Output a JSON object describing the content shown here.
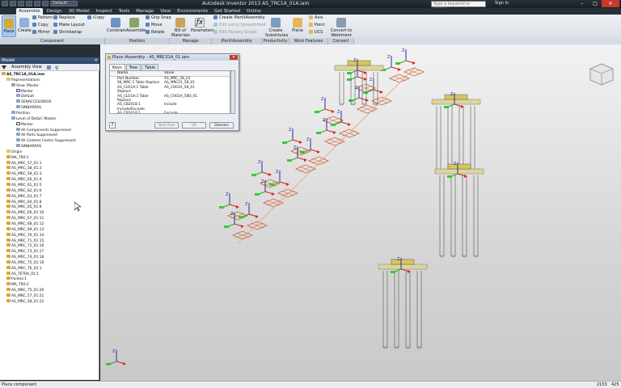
{
  "window": {
    "title": "Autodesk Inventor 2013   AS_TRC1A_01A.iam",
    "project_selector": "Default",
    "search_placeholder": "Type a keyword or phrase",
    "signin": "Sign In",
    "minimize": "–",
    "maximize": "□",
    "close": "✕"
  },
  "ribbon_tabs": [
    "Assemble",
    "Design",
    "3D Model",
    "Inspect",
    "Tools",
    "Manage",
    "View",
    "Environments",
    "Get Started",
    "Online"
  ],
  "ribbon": {
    "place": "Place",
    "create": "Create",
    "pattern": "Pattern",
    "copy": "Copy",
    "mirror": "Mirror",
    "replace": "Replace",
    "make_layout": "Make Layout",
    "shrinkwrap": "Shrinkwrap",
    "icopy": "iCopy",
    "constrain": "Constrain",
    "assemble": "Assemble",
    "grip_snap": "Grip Snap",
    "move": "Move",
    "rotate": "Rotate",
    "bill_of_materials": "Bill of Materials",
    "parameters": "Parameters",
    "create_ipart": "Create iPart/iAssembly",
    "edit_spreadsheet": "Edit using Spreadsheet",
    "edit_factory_scope": "Edit Factory Scope",
    "create_substitutes": "Create Substitutes",
    "plane": "Plane",
    "axis": "Axis",
    "point": "Point",
    "ucs": "UCS",
    "convert_weldment": "Convert to Weldment",
    "panels": {
      "component": "Component",
      "position": "Position",
      "manage": "Manage",
      "ipart": "iPart/iAssembly",
      "productivity": "Productivity",
      "work_features": "Work Features",
      "convert": "Convert"
    }
  },
  "browser": {
    "title": "Model",
    "view_selector": "Assembly View",
    "nodes": [
      {
        "label": "AS_TRC1A_01A.iam",
        "indent": 0,
        "icon": "asm",
        "bold": true
      },
      {
        "label": "Representations",
        "indent": 1,
        "icon": "fold"
      },
      {
        "label": "View: Master",
        "indent": 2,
        "icon": "view"
      },
      {
        "label": "Master",
        "indent": 3,
        "icon": "chk"
      },
      {
        "label": "Default",
        "indent": 3,
        "icon": "view"
      },
      {
        "label": "SENACCESORIOS",
        "indent": 3,
        "icon": "view"
      },
      {
        "label": "SINBARRAS",
        "indent": 3,
        "icon": "view"
      },
      {
        "label": "Position",
        "indent": 2,
        "icon": "view"
      },
      {
        "label": "Level of Detail: Master",
        "indent": 2,
        "icon": "view"
      },
      {
        "label": "Master",
        "indent": 3,
        "icon": "chk"
      },
      {
        "label": "All Components Suppressed",
        "indent": 3,
        "icon": "view"
      },
      {
        "label": "All Parts Suppressed",
        "indent": 3,
        "icon": "view"
      },
      {
        "label": "All Content Center Suppressed",
        "indent": 3,
        "icon": "view"
      },
      {
        "label": "SINBARRAS",
        "indent": 3,
        "icon": "view"
      },
      {
        "label": "Origin",
        "indent": 1,
        "icon": "fold"
      },
      {
        "label": "MA_TR0:1",
        "indent": 1,
        "icon": "asm"
      },
      {
        "label": "AS_MRC_57_01:1",
        "indent": 1,
        "icon": "asm"
      },
      {
        "label": "AS_MRC_58_01:2",
        "indent": 1,
        "icon": "asm"
      },
      {
        "label": "AS_MRC_59_01:3",
        "indent": 1,
        "icon": "asm"
      },
      {
        "label": "AS_MRC_60_01:4",
        "indent": 1,
        "icon": "asm"
      },
      {
        "label": "AS_MRC_61_01:5",
        "indent": 1,
        "icon": "asm"
      },
      {
        "label": "AS_MRC_62_01:6",
        "indent": 1,
        "icon": "asm"
      },
      {
        "label": "AS_MRC_63_01:7",
        "indent": 1,
        "icon": "asm"
      },
      {
        "label": "AS_MRC_64_01:8",
        "indent": 1,
        "icon": "asm"
      },
      {
        "label": "AS_MRC_65_01:9",
        "indent": 1,
        "icon": "asm"
      },
      {
        "label": "AS_MRC_66_01:10",
        "indent": 1,
        "icon": "asm"
      },
      {
        "label": "AS_MRC_67_01:11",
        "indent": 1,
        "icon": "asm"
      },
      {
        "label": "AS_MRC_68_01:12",
        "indent": 1,
        "icon": "asm"
      },
      {
        "label": "AS_MRC_69_01:13",
        "indent": 1,
        "icon": "asm"
      },
      {
        "label": "AS_MRC_70_01:14",
        "indent": 1,
        "icon": "asm"
      },
      {
        "label": "AS_MRC_71_01:15",
        "indent": 1,
        "icon": "asm"
      },
      {
        "label": "AS_MRC_72_01:16",
        "indent": 1,
        "icon": "asm"
      },
      {
        "label": "AS_MRC_73_01:17",
        "indent": 1,
        "icon": "asm"
      },
      {
        "label": "AS_MRC_74_01:18",
        "indent": 1,
        "icon": "asm"
      },
      {
        "label": "AS_MRC_75_01:19",
        "indent": 1,
        "icon": "asm"
      },
      {
        "label": "AS_MRC_76_02:1",
        "indent": 1,
        "icon": "asm"
      },
      {
        "label": "AS_TETRA_01:1",
        "indent": 1,
        "icon": "asm"
      },
      {
        "label": "Puntos:1",
        "indent": 1,
        "icon": "asm"
      },
      {
        "label": "MA_TR0:2",
        "indent": 1,
        "icon": "asm"
      },
      {
        "label": "AS_MRC_75_01:20",
        "indent": 1,
        "icon": "asm"
      },
      {
        "label": "AS_MRC_57_01:21",
        "indent": 1,
        "icon": "asm"
      },
      {
        "label": "AS_MRC_58_01:22",
        "indent": 1,
        "icon": "asm"
      }
    ]
  },
  "dialog": {
    "title": "Place iAssembly - AS_MRC01A_01.iam",
    "tabs": [
      "Keys",
      "Tree",
      "Table"
    ],
    "columns": [
      "Name",
      "Value"
    ],
    "rows": [
      [
        "Part Number",
        "AS_MRC_58_01"
      ],
      [
        "SK_MRC:1 Table Replace",
        "AS_MRC01_58_01"
      ],
      [
        "AS_CLO1A:1 Table Replace",
        "AS_CO01A_58_01"
      ],
      [
        "AS_CLO1A:2 Table Replace",
        "AS_CO01A_58D_01"
      ],
      [
        "AS_CB2018:1 Include/Exclude",
        "Include"
      ],
      [
        "AS_CB2018:1 Include/Exclude",
        "Exclude"
      ]
    ],
    "buttons": {
      "new_row": "New Row",
      "ok": "OK",
      "dismiss": "Dismiss"
    },
    "help": "?"
  },
  "status": {
    "message": "Place component",
    "count1": "2153",
    "count2": "425"
  },
  "colors": {
    "accent": "#3b5b82",
    "dialog_bg": "#e9edf2",
    "viewport_top": "#f2f2f2"
  }
}
